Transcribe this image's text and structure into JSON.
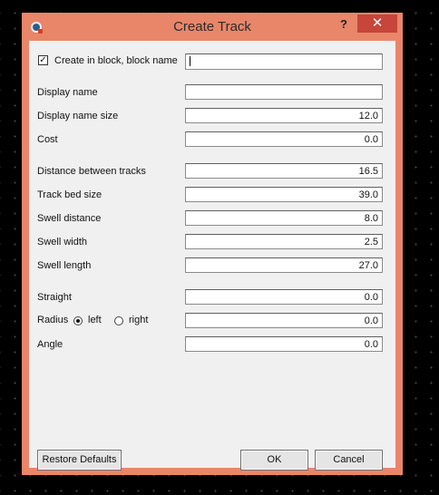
{
  "window": {
    "title": "Create Track",
    "help": "?",
    "close": "✕"
  },
  "block": {
    "label": "Create in block, block name",
    "checked": true,
    "value": ""
  },
  "fields": {
    "display_name": {
      "label": "Display name",
      "value": ""
    },
    "display_size": {
      "label": "Display name size",
      "value": "12.0"
    },
    "cost": {
      "label": "Cost",
      "value": "0.0"
    },
    "distance": {
      "label": "Distance between tracks",
      "value": "16.5"
    },
    "bed_size": {
      "label": "Track bed size",
      "value": "39.0"
    },
    "swell_distance": {
      "label": "Swell distance",
      "value": "8.0"
    },
    "swell_width": {
      "label": "Swell width",
      "value": "2.5"
    },
    "swell_length": {
      "label": "Swell length",
      "value": "27.0"
    },
    "straight": {
      "label": "Straight",
      "value": "0.0"
    },
    "radius": {
      "label": "Radius",
      "value": "0.0"
    },
    "angle": {
      "label": "Angle",
      "value": "0.0"
    }
  },
  "radius_options": {
    "left": "left",
    "right": "right",
    "selected": "left"
  },
  "buttons": {
    "restore": "Restore Defaults",
    "ok": "OK",
    "cancel": "Cancel"
  }
}
